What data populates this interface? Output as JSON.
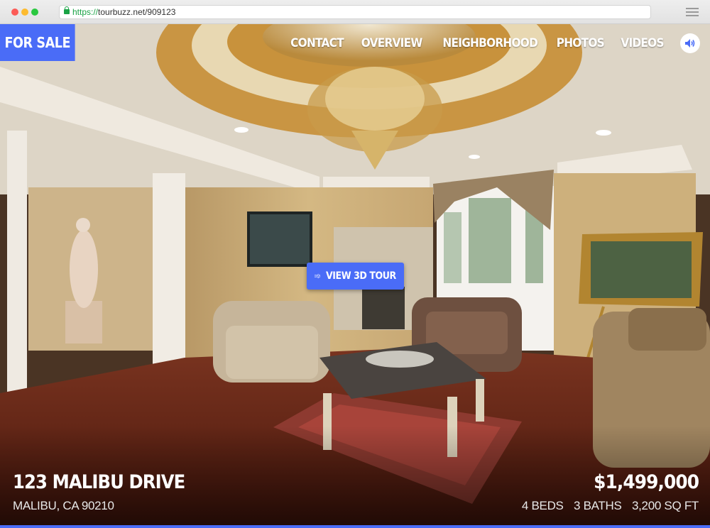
{
  "browser": {
    "url_scheme": "https://",
    "url_rest": "tourbuzz.net/909123"
  },
  "badge": {
    "label": "FOR SALE"
  },
  "nav": {
    "items": [
      "CONTACT",
      "OVERVIEW",
      "NEIGHBORHOOD",
      "PHOTOS",
      "VIDEOS"
    ],
    "sound_icon": "speaker-icon"
  },
  "tour_button": {
    "label": "VIEW 3D TOUR",
    "icon": "3d-cube-icon"
  },
  "listing": {
    "street": "123 MALIBU DRIVE",
    "city": "MALIBU, CA  90210",
    "price": "$1,499,000",
    "beds": "4 BEDS",
    "baths": "3 BATHS",
    "sqft": "3,200 SQ FT"
  },
  "colors": {
    "accent": "#4a6cf7",
    "wall": "#c9ac78",
    "floor": "#6b2a1a"
  }
}
